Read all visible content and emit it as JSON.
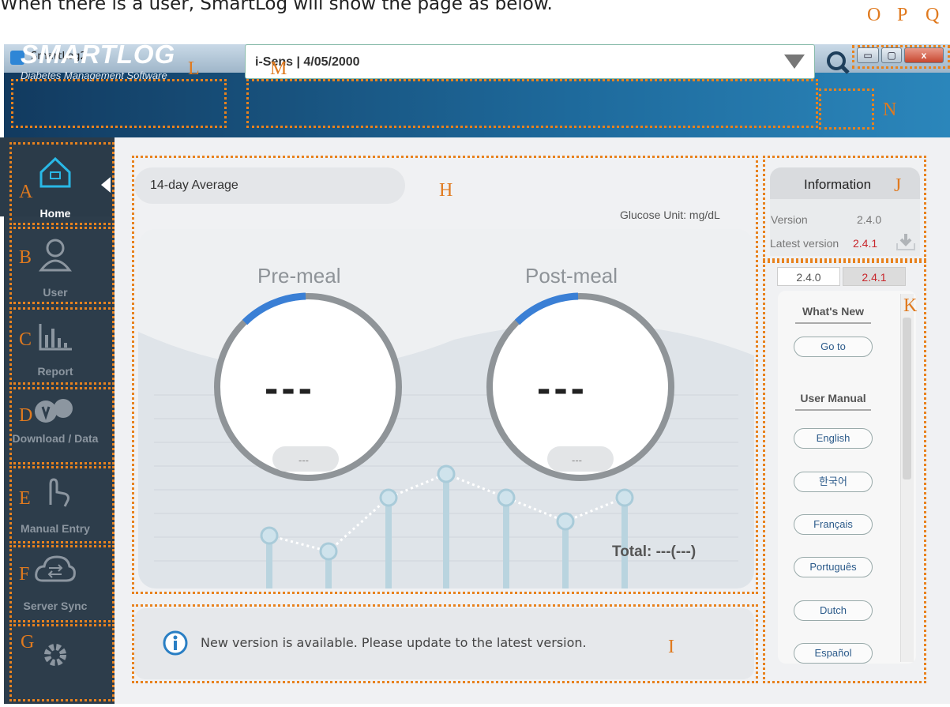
{
  "caption": "When there is a user, SmartLog will show the page as below.",
  "window": {
    "title": "SmartLog2",
    "minimize_label": "▭",
    "maximize_label": "▢",
    "close_label": "x"
  },
  "header": {
    "logo_main": "SMARTLOG",
    "logo_sub": "Diabetes Management Software",
    "user_selection": "i-Sens | 4/05/2000"
  },
  "sidebar": {
    "items": [
      {
        "label": "Home",
        "icon": "home-icon"
      },
      {
        "label": "User",
        "icon": "user-icon"
      },
      {
        "label": "Report",
        "icon": "report-icon"
      },
      {
        "label": "Download / Data",
        "icon": "download-icon"
      },
      {
        "label": "Manual Entry",
        "icon": "hand-icon"
      },
      {
        "label": "Server Sync",
        "icon": "cloud-sync-icon"
      },
      {
        "label": "",
        "icon": "gear-icon"
      }
    ]
  },
  "main": {
    "average_label": "14-day Average",
    "glucose_unit": "Glucose Unit: mg/dL",
    "pre_meal": {
      "label": "Pre-meal",
      "value": "---",
      "sub": "---"
    },
    "post_meal": {
      "label": "Post-meal",
      "value": "---",
      "sub": "---"
    },
    "total": "Total: ---(---)",
    "info_message": "New version is available. Please update to the latest version."
  },
  "information": {
    "title": "Information",
    "version_label": "Version",
    "version_value": "2.4.0",
    "latest_label": "Latest version",
    "latest_value": "2.4.1",
    "tabs": [
      "2.4.0",
      "2.4.1"
    ],
    "whats_new": "What's New",
    "goto": "Go to",
    "user_manual": "User Manual",
    "languages": [
      "English",
      "한국어",
      "Français",
      "Português",
      "Dutch",
      "Español"
    ]
  },
  "annotations": {
    "A": "A",
    "B": "B",
    "C": "C",
    "D": "D",
    "E": "E",
    "F": "F",
    "G": "G",
    "H": "H",
    "I": "I",
    "J": "J",
    "K": "K",
    "L": "L",
    "M": "M",
    "N": "N",
    "O": "O",
    "P": "P",
    "Q": "Q"
  },
  "colors": {
    "accent_orange": "#e8821e",
    "latest_red": "#c8262b",
    "ring_blue": "#3a7fd5"
  }
}
